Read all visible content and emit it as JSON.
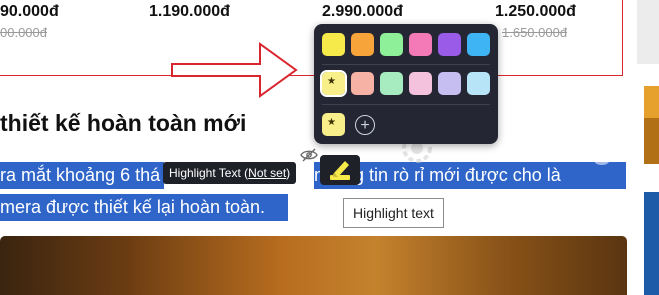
{
  "prices": [
    {
      "current": "90.000đ",
      "old": "00.000đ"
    },
    {
      "current": "1.190.000đ",
      "old": ""
    },
    {
      "current": "2.990.000đ",
      "old": ""
    },
    {
      "current": "1.250.000đ",
      "old": "1.650.000đ"
    }
  ],
  "article": {
    "heading": "thiết kế hoàn toàn mới",
    "line1_left": "ra mắt khoảng 6 thá",
    "line1_right": "nhông tin rò rỉ mới được cho là",
    "line2": "mera được thiết kế lại hoàn toàn."
  },
  "palette": {
    "row1": [
      "#f6ea4a",
      "#f7a43a",
      "#8ff09a",
      "#f479b7",
      "#9a5be8",
      "#3fb4f5"
    ],
    "row2": [
      "#f8ee8a",
      "#f7b2a6",
      "#a7ebc1",
      "#f5c2de",
      "#c6bdf0",
      "#b7e4f7"
    ],
    "custom": [
      "#f8ee8a"
    ],
    "add_label": "+"
  },
  "tooltip_dark": {
    "prefix": "Highlight Text (",
    "link": "Not set",
    "suffix": ")"
  },
  "tooltip_light": "Highlight text",
  "watermark": "uantrimang",
  "colors": {
    "accent_red": "#d9262e",
    "selection": "#2f65c9",
    "popup": "#242733"
  }
}
